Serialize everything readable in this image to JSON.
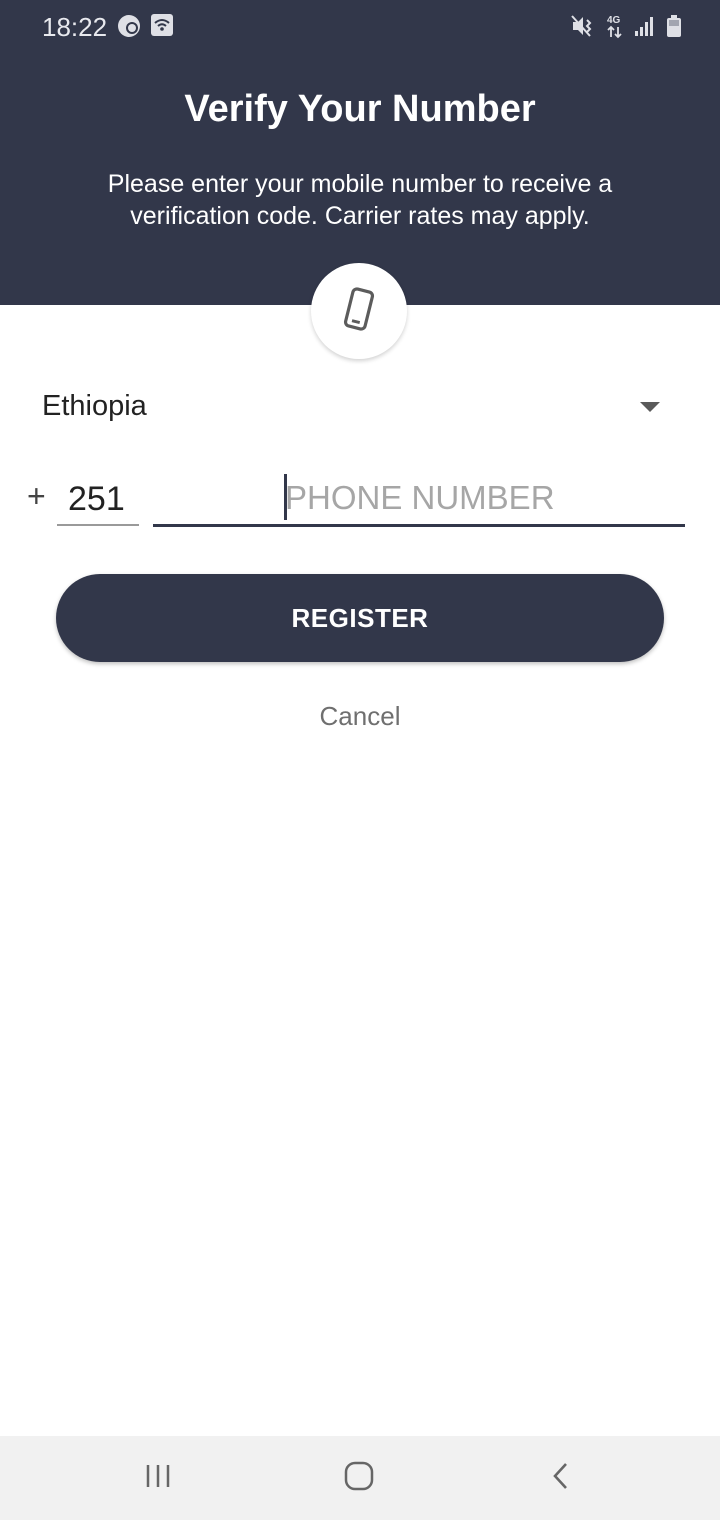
{
  "status_bar": {
    "time": "18:22",
    "network": "4G",
    "icons": [
      "ad-blocker-icon",
      "wifi-hotspot-icon",
      "vibrate-mute-icon",
      "network-4g-icon",
      "signal-icon",
      "battery-icon"
    ]
  },
  "header": {
    "title": "Verify Your Number",
    "subtitle": "Please enter your mobile number to receive a verification code. Carrier rates may apply.",
    "badge_icon": "mobile-phone-icon"
  },
  "form": {
    "country": "Ethiopia",
    "plus_sign": "+",
    "country_code": "251",
    "phone_value": "",
    "phone_placeholder": "PHONE NUMBER",
    "register_label": "REGISTER",
    "cancel_label": "Cancel"
  },
  "nav_bar": {
    "icons": [
      "recent-apps-icon",
      "home-icon",
      "back-icon"
    ]
  },
  "colors": {
    "header_bg": "#32374a",
    "button_bg": "#32374a",
    "nav_bg": "#f1f1f1"
  }
}
